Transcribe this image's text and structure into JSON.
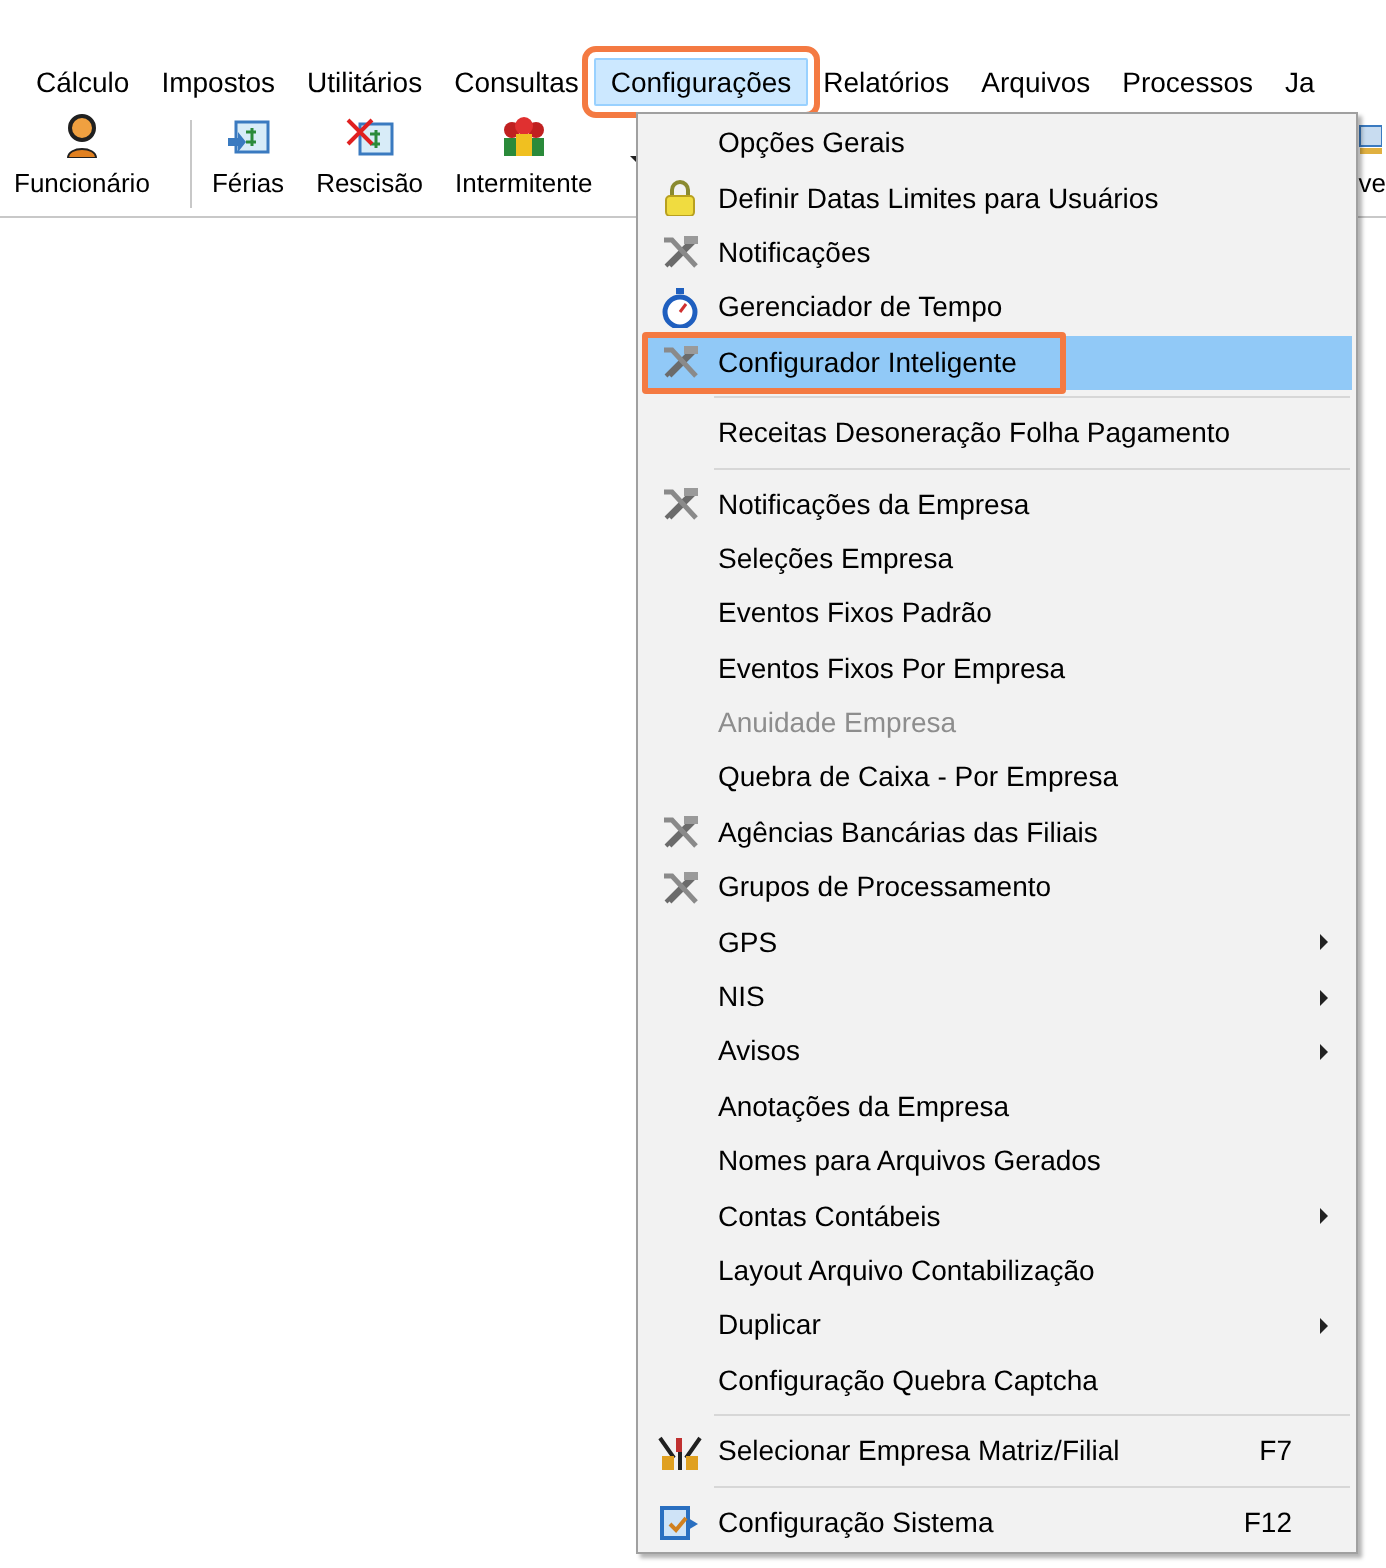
{
  "menu_bar": [
    {
      "label": "Cálculo",
      "selected": false,
      "annotated": false
    },
    {
      "label": "Impostos",
      "selected": false,
      "annotated": false
    },
    {
      "label": "Utilitários",
      "selected": false,
      "annotated": false
    },
    {
      "label": "Consultas",
      "selected": false,
      "annotated": false
    },
    {
      "label": "Configurações",
      "selected": true,
      "annotated": true
    },
    {
      "label": "Relatórios",
      "selected": false,
      "annotated": false
    },
    {
      "label": "Arquivos",
      "selected": false,
      "annotated": false
    },
    {
      "label": "Processos",
      "selected": false,
      "annotated": false
    },
    {
      "label": "Ja",
      "selected": false,
      "annotated": false
    }
  ],
  "toolbar": [
    {
      "kind": "button",
      "label": "Funcionário"
    },
    {
      "kind": "separator"
    },
    {
      "kind": "button",
      "label": "Férias"
    },
    {
      "kind": "button",
      "label": "Rescisão"
    },
    {
      "kind": "button",
      "label": "Intermitente"
    },
    {
      "kind": "dropdown"
    },
    {
      "kind": "button",
      "label": "ve"
    }
  ],
  "menu": [
    {
      "kind": "item",
      "label": "Opções Gerais",
      "disabled": false,
      "submenu": false,
      "selected": false,
      "annotated": false
    },
    {
      "kind": "item",
      "label": "Definir Datas Limites para Usuários",
      "disabled": false,
      "submenu": false,
      "selected": false,
      "annotated": false
    },
    {
      "kind": "item",
      "label": "Notificações",
      "disabled": false,
      "submenu": false,
      "selected": false,
      "annotated": false
    },
    {
      "kind": "item",
      "label": "Gerenciador de Tempo",
      "disabled": false,
      "submenu": false,
      "selected": false,
      "annotated": false
    },
    {
      "kind": "item",
      "label": "Configurador Inteligente",
      "disabled": false,
      "submenu": false,
      "selected": true,
      "annotated": true
    },
    {
      "kind": "separator"
    },
    {
      "kind": "item",
      "label": "Receitas Desoneração Folha Pagamento",
      "disabled": false,
      "submenu": false,
      "selected": false,
      "annotated": false
    },
    {
      "kind": "separator"
    },
    {
      "kind": "item",
      "label": "Notificações da Empresa",
      "disabled": false,
      "submenu": false,
      "selected": false,
      "annotated": false
    },
    {
      "kind": "item",
      "label": "Seleções Empresa",
      "disabled": false,
      "submenu": false,
      "selected": false,
      "annotated": false
    },
    {
      "kind": "item",
      "label": "Eventos Fixos Padrão",
      "disabled": false,
      "submenu": false,
      "selected": false,
      "annotated": false
    },
    {
      "kind": "item",
      "label": "Eventos Fixos Por Empresa",
      "disabled": false,
      "submenu": false,
      "selected": false,
      "annotated": false
    },
    {
      "kind": "item",
      "label": "Anuidade Empresa",
      "disabled": true,
      "submenu": false,
      "selected": false,
      "annotated": false
    },
    {
      "kind": "item",
      "label": "Quebra de Caixa - Por Empresa",
      "disabled": false,
      "submenu": false,
      "selected": false,
      "annotated": false
    },
    {
      "kind": "item",
      "label": "Agências Bancárias das Filiais",
      "disabled": false,
      "submenu": false,
      "selected": false,
      "annotated": false
    },
    {
      "kind": "item",
      "label": "Grupos de Processamento",
      "disabled": false,
      "submenu": false,
      "selected": false,
      "annotated": false
    },
    {
      "kind": "item",
      "label": "GPS",
      "disabled": false,
      "submenu": true,
      "selected": false,
      "annotated": false
    },
    {
      "kind": "item",
      "label": "NIS",
      "disabled": false,
      "submenu": true,
      "selected": false,
      "annotated": false
    },
    {
      "kind": "item",
      "label": "Avisos",
      "disabled": false,
      "submenu": true,
      "selected": false,
      "annotated": false
    },
    {
      "kind": "item",
      "label": "Anotações da Empresa",
      "disabled": false,
      "submenu": false,
      "selected": false,
      "annotated": false
    },
    {
      "kind": "item",
      "label": "Nomes para Arquivos Gerados",
      "disabled": false,
      "submenu": false,
      "selected": false,
      "annotated": false
    },
    {
      "kind": "item",
      "label": "Contas Contábeis",
      "disabled": false,
      "submenu": true,
      "selected": false,
      "annotated": false
    },
    {
      "kind": "item",
      "label": "Layout Arquivo Contabilização",
      "disabled": false,
      "submenu": false,
      "selected": false,
      "annotated": false
    },
    {
      "kind": "item",
      "label": "Duplicar",
      "disabled": false,
      "submenu": true,
      "selected": false,
      "annotated": false
    },
    {
      "kind": "item",
      "label": "Configuração Quebra Captcha",
      "disabled": false,
      "submenu": false,
      "selected": false,
      "annotated": false
    },
    {
      "kind": "separator"
    },
    {
      "kind": "item",
      "label": "Selecionar Empresa Matriz/Filial",
      "shortcut": "F7",
      "disabled": false,
      "submenu": false,
      "selected": false,
      "annotated": false
    },
    {
      "kind": "separator"
    },
    {
      "kind": "item",
      "label": "Configuração Sistema",
      "shortcut": "F12",
      "disabled": false,
      "submenu": false,
      "selected": false,
      "annotated": false
    }
  ]
}
